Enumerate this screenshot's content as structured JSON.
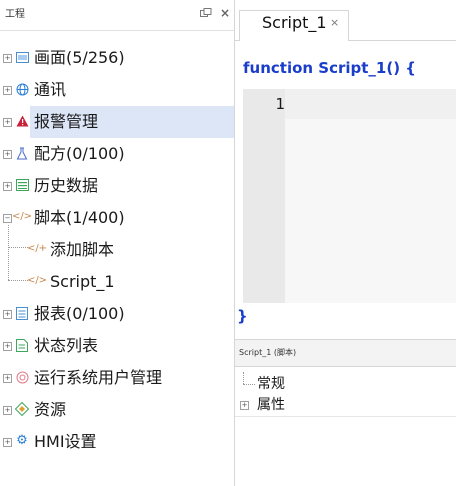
{
  "left_panel": {
    "title": "工程",
    "pin_icon": "pin-icon",
    "close_icon": "close-icon",
    "tree": [
      {
        "label": "画面(5/256)",
        "icon": "screen-icon",
        "icon_color": "#4a8fcf"
      },
      {
        "label": "通讯",
        "icon": "globe-icon",
        "icon_color": "#2c7fd6"
      },
      {
        "label": "报警管理",
        "icon": "alarm-icon",
        "icon_color": "#c8213a",
        "selected": true
      },
      {
        "label": "配方(0/100)",
        "icon": "flask-icon",
        "icon_color": "#4a6ec8"
      },
      {
        "label": "历史数据",
        "icon": "history-data-icon",
        "icon_color": "#3da65c"
      },
      {
        "label": "脚本(1/400)",
        "icon": "script-icon",
        "icon_color": "#c8864a",
        "expanded": true
      },
      {
        "label": "添加脚本",
        "icon": "add-script-icon",
        "icon_color": "#c8864a",
        "child": true
      },
      {
        "label": "Script_1",
        "icon": "script-file-icon",
        "icon_color": "#c8864a",
        "child": true
      },
      {
        "label": "报表(0/100)",
        "icon": "report-icon",
        "icon_color": "#4a8fcf"
      },
      {
        "label": "状态列表",
        "icon": "status-list-icon",
        "icon_color": "#3da65c"
      },
      {
        "label": "运行系统用户管理",
        "icon": "user-manage-icon",
        "icon_color": "#e07b8a"
      },
      {
        "label": "资源",
        "icon": "resource-icon",
        "icon_color": "#3da65c"
      },
      {
        "label": "HMI设置",
        "icon": "gear-icon",
        "icon_color": "#2c7fd6"
      }
    ]
  },
  "tab": {
    "label": "Script_1",
    "icon": "script-icon",
    "close": "×"
  },
  "editor": {
    "function_header": "function Script_1() {",
    "line_number": "1",
    "closing_brace": "}"
  },
  "properties": {
    "title": "Script_1 (脚本)",
    "rows": [
      {
        "label": "常规",
        "expander": false
      },
      {
        "label": "属性",
        "expander": true
      }
    ]
  },
  "colors": {
    "accent_blue": "#1a3ec9",
    "selection": "#dce6f7",
    "alarm_red": "#c8213a"
  }
}
